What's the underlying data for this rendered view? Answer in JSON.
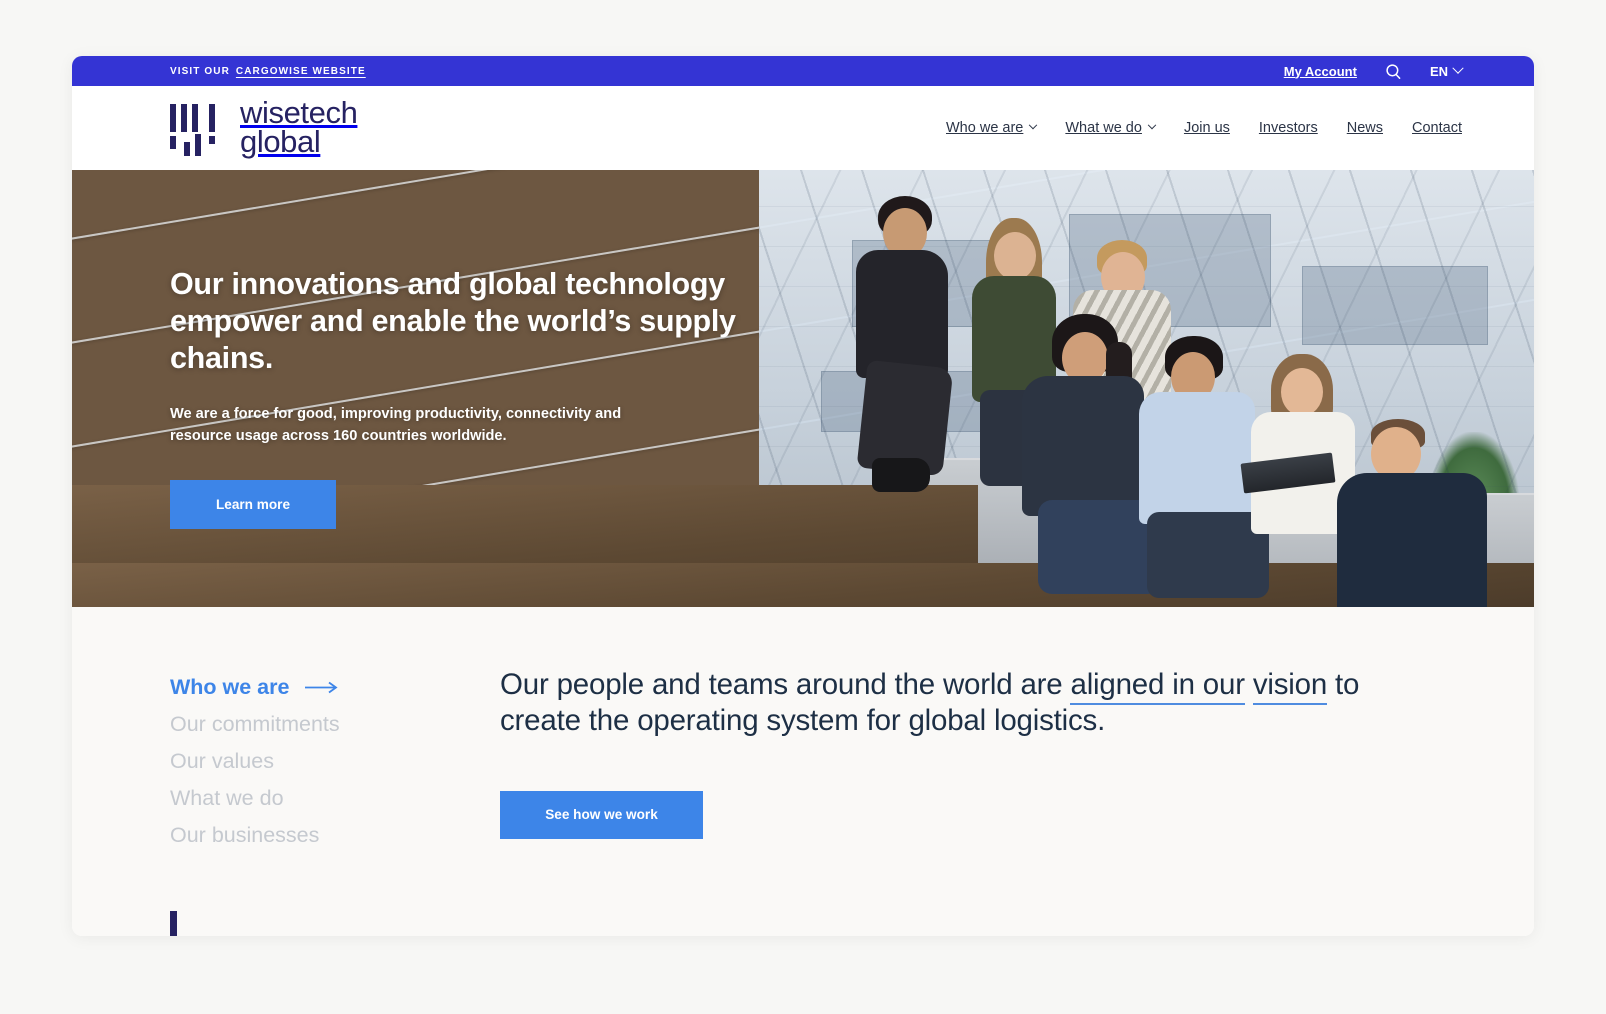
{
  "utility_bar": {
    "visit_label": "VISIT OUR",
    "cargowise_link": "CARGOWISE WEBSITE",
    "my_account": "My Account",
    "search_icon": "search-icon",
    "language": "EN",
    "language_chevron": "chevron-down-icon",
    "background_color": "#3434d4"
  },
  "masthead": {
    "logo_line1": "wisetech",
    "logo_line2": "global",
    "logo_color": "#262262",
    "nav": [
      {
        "label": "Who we are",
        "has_dropdown": true
      },
      {
        "label": "What we do",
        "has_dropdown": true
      },
      {
        "label": "Join us",
        "has_dropdown": false
      },
      {
        "label": "Investors",
        "has_dropdown": false
      },
      {
        "label": "News",
        "has_dropdown": false
      },
      {
        "label": "Contact",
        "has_dropdown": false
      }
    ]
  },
  "hero": {
    "title": "Our innovations and global technology empower and enable the world’s supply chains.",
    "subtitle": "We are a force for good, improving productivity, connectivity and resource usage across 160 countries worldwide.",
    "cta_label": "Learn more",
    "cta_color": "#3d85e8",
    "image_description": "Group of seven colleagues seated on wooden and concrete steps in a modern glass-walled office atrium, looking at a laptop"
  },
  "lower_section": {
    "side_items": [
      {
        "label": "Who we are",
        "active": true,
        "arrow": "arrow-right-icon"
      },
      {
        "label": "Our commitments",
        "active": false
      },
      {
        "label": "Our values",
        "active": false
      },
      {
        "label": "What we do",
        "active": false
      },
      {
        "label": "Our businesses",
        "active": false
      }
    ],
    "lead_text_part1": "Our people and teams around the world are ",
    "lead_highlight_1": "aligned in our",
    "lead_highlight_2": "vision",
    "lead_text_part2": " to create the operating system for global logistics.",
    "cta_label": "See how we work",
    "cta_color": "#3d85e8",
    "active_color": "#3d85e8",
    "muted_color": "#c5c9cf"
  }
}
